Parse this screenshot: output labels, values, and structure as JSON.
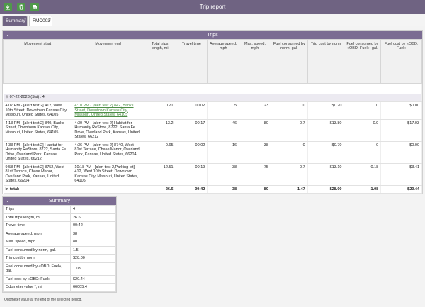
{
  "window": {
    "title": "Trip report"
  },
  "toolbar": {
    "buttons": [
      "download-icon",
      "trash-icon",
      "print-icon"
    ]
  },
  "tabs": [
    {
      "label": "Summary",
      "active": false
    },
    {
      "label": "FMC003",
      "active": true
    }
  ],
  "trips": {
    "title": "Trips",
    "columns": [
      "Movement start",
      "Movement end",
      "Total trips length, mi",
      "Travel time",
      "Average speed, mph",
      "Max. speed, mph",
      "Fuel consumed by norm, gal.",
      "Trip cost by norm",
      "Fuel consumed by «OBD: Fuel», gal.",
      "Fuel cost by «OBD: Fuel»"
    ],
    "group": "07-22-2023 (Sat) : 4",
    "rows": [
      {
        "start": "4:07 PM - [alert test 2] 412, West 10th Street, Downtown Kansas City, Missouri, United States, 64105",
        "end": "4:10 PM - [alert test 2] 842, Banks Street, Downtown Kansas City, Missouri, United States, 64105",
        "length": "0.21",
        "time": "00:02",
        "avg": "5",
        "max": "23",
        "fuel_norm": "0",
        "cost_norm": "$0.20",
        "fuel_obd": "0",
        "cost_obd": "$0.00"
      },
      {
        "start": "4:13 PM - [alert test 2] 840, Banks Street, Downtown Kansas City, Missouri, United States, 64105",
        "end": "4:30 PM - [alert test 2] Habitat for Humanity ReStore, 8722, Santa Fe Drive, Overland Park, Kansas, United States, 66212",
        "length": "13.2",
        "time": "00:17",
        "avg": "46",
        "max": "80",
        "fuel_norm": "0.7",
        "cost_norm": "$13.80",
        "fuel_obd": "0.9",
        "cost_obd": "$17.03"
      },
      {
        "start": "4:33 PM - [alert test 2] Habitat for Humanity ReStore, 8722, Santa Fe Drive, Overland Park, Kansas, United States, 66212",
        "end": "4:36 PM - [alert test 2] 8740, West 81st Terrace, Chase Manor, Overland Park, Kansas, United States, 66204",
        "length": "0.65",
        "time": "00:02",
        "avg": "16",
        "max": "38",
        "fuel_norm": "0",
        "cost_norm": "$0.70",
        "fuel_obd": "0",
        "cost_obd": "$0.00"
      },
      {
        "start": "9:58 PM - [alert test 2] 8752, West 81st Terrace, Chase Manor, Overland Park, Kansas, United States, 66204",
        "end": "10:18 PM - [alert test 2,Parking lot] 412, West 10th Street, Downtown Kansas City, Missouri, United States, 64105",
        "length": "12.51",
        "time": "00:19",
        "avg": "38",
        "max": "75",
        "fuel_norm": "0.7",
        "cost_norm": "$13.10",
        "fuel_obd": "0.18",
        "cost_obd": "$3.41"
      }
    ],
    "total": {
      "label": "In total:",
      "length": "26.6",
      "time": "00:42",
      "avg": "38",
      "max": "80",
      "fuel_norm": "1.47",
      "cost_norm": "$28.00",
      "fuel_obd": "1.08",
      "cost_obd": "$20.44"
    }
  },
  "summary": {
    "title": "Summary",
    "rows": [
      {
        "k": "Trips",
        "v": "4"
      },
      {
        "k": "Total trips length, mi",
        "v": "26.6"
      },
      {
        "k": "Travel time",
        "v": "00:42"
      },
      {
        "k": "Average speed, mph",
        "v": "38"
      },
      {
        "k": "Max. speed, mph",
        "v": "80"
      },
      {
        "k": "Fuel consumed by norm, gal.",
        "v": "1.5"
      },
      {
        "k": "Trip cost by norm",
        "v": "$28.00"
      },
      {
        "k": "Fuel consumed by «OBD: Fuel», gal.",
        "v": "1.08"
      },
      {
        "k": "Fuel cost by «OBD: Fuel»",
        "v": "$20.44"
      },
      {
        "k": "Odometer value *, mi",
        "v": "66005.4"
      }
    ]
  },
  "footnote": "Odometer value at the end of the selected period."
}
